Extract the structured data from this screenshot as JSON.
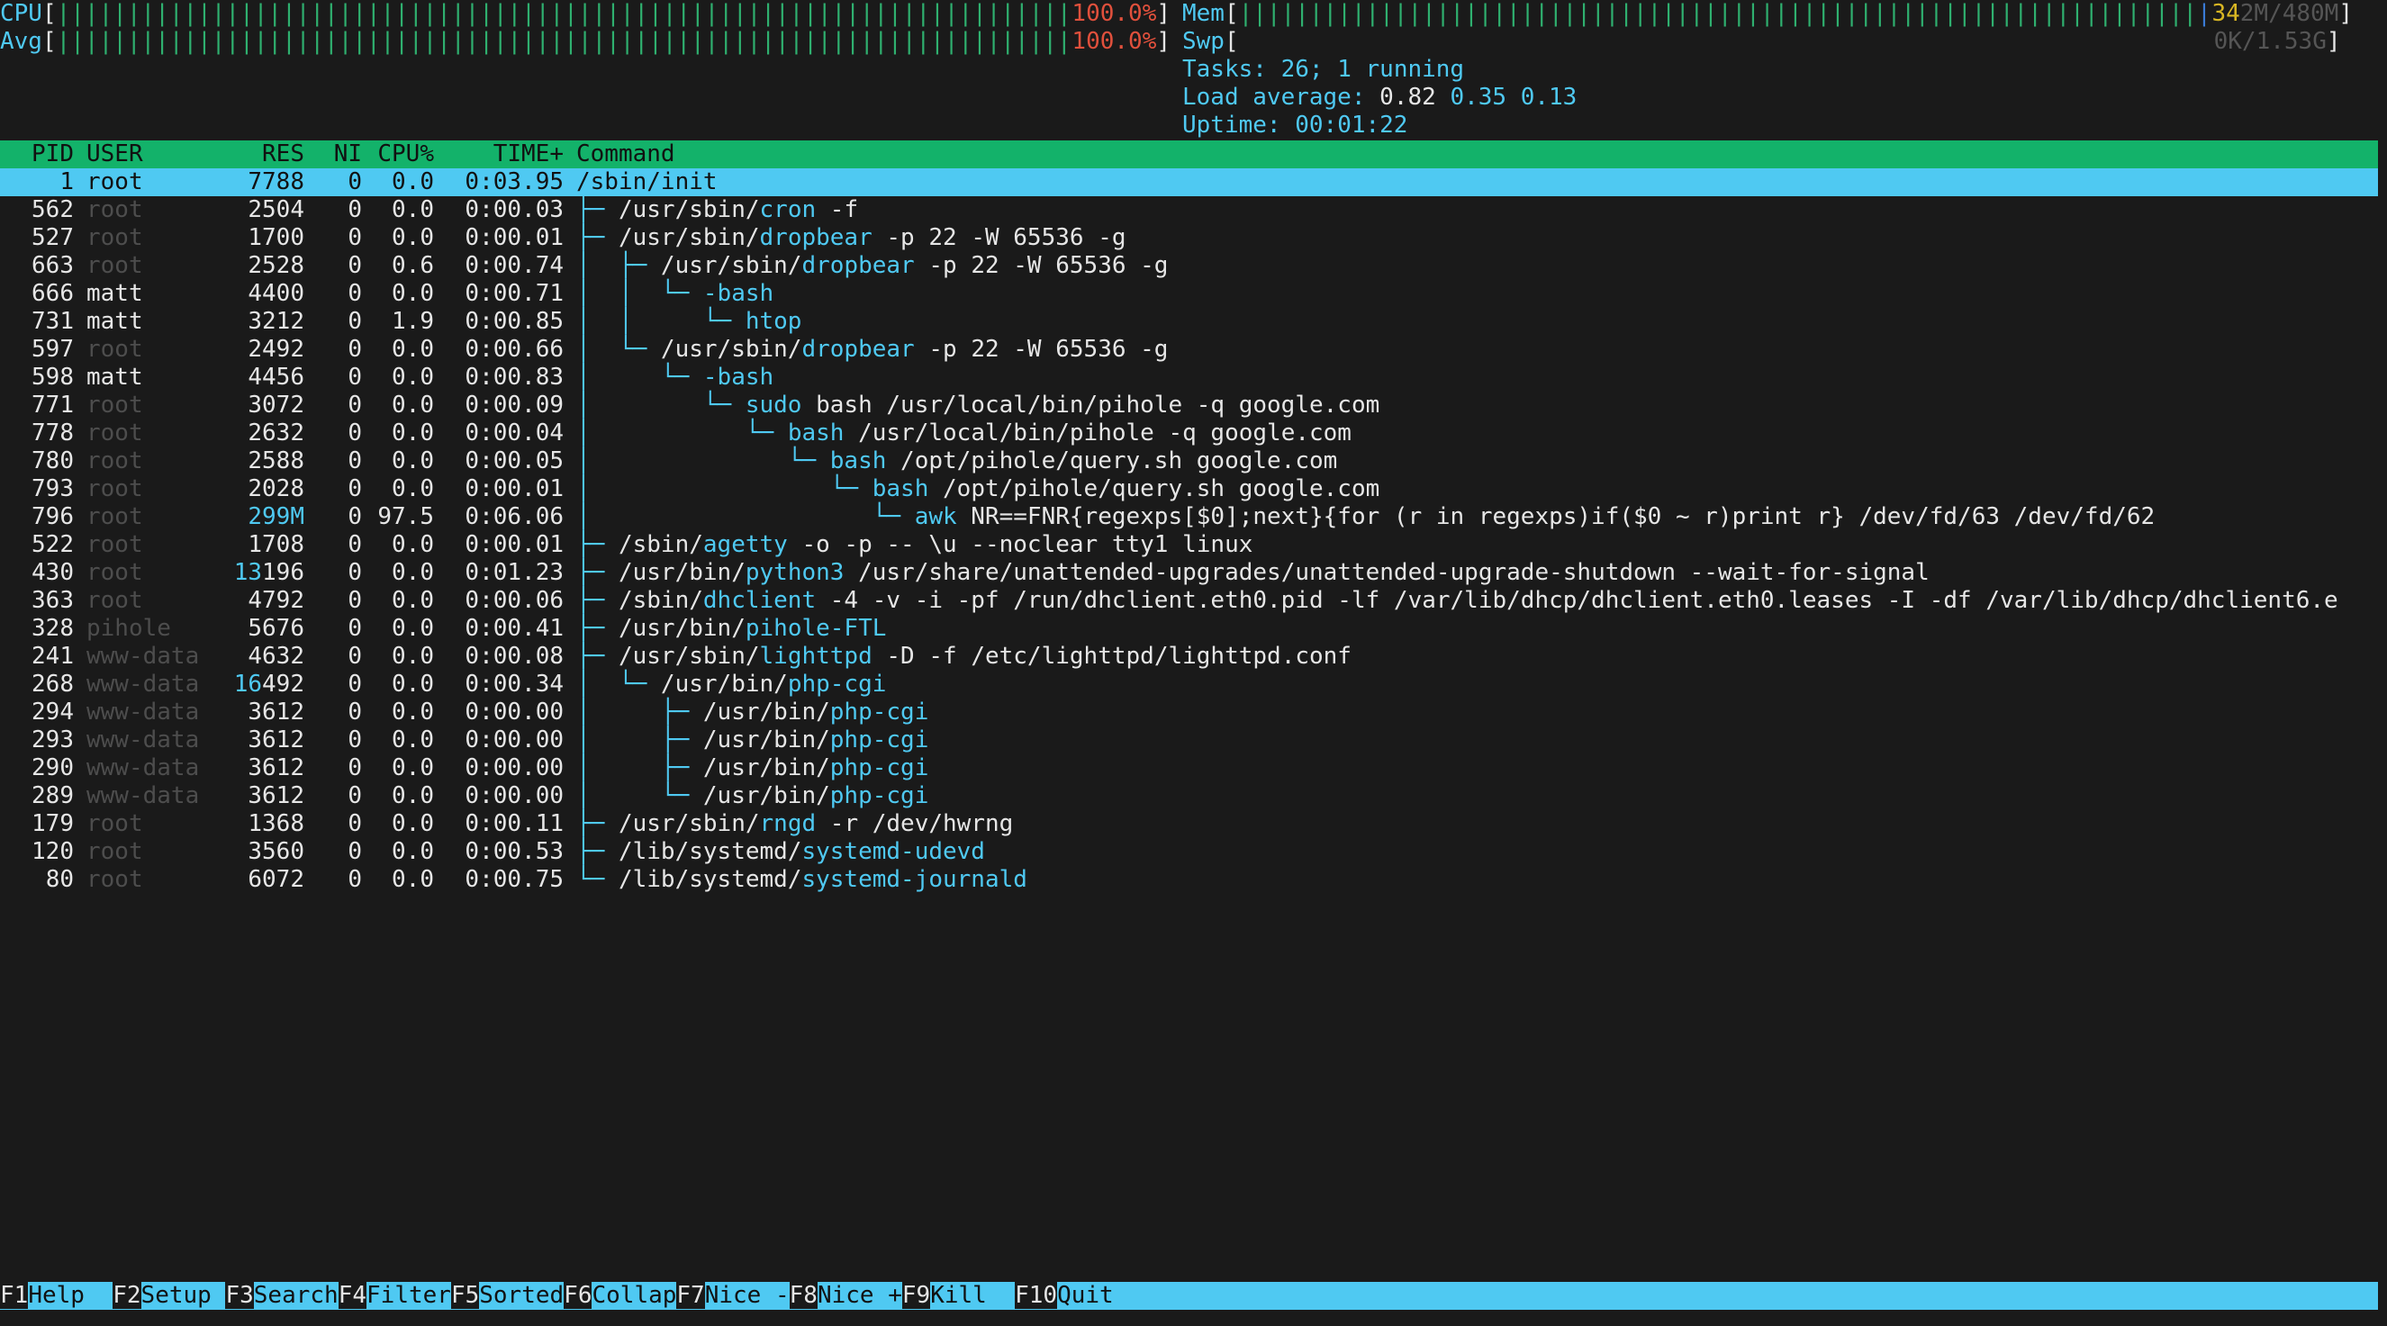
{
  "meters": {
    "cpu": {
      "label": "CPU",
      "percent_text": "100.0%",
      "fill": 1.0
    },
    "avg": {
      "label": "Avg",
      "percent_text": "100.0%",
      "fill": 1.0
    },
    "mem": {
      "label": "Mem",
      "text_bright": "34",
      "text_dim": "2M/480M",
      "fill": 1.0
    },
    "swp": {
      "label": "Swp",
      "text": "0K/1.53G",
      "fill": 0.0
    },
    "tasks": {
      "label": "Tasks:",
      "value": "26;",
      "running_count": "1",
      "running_label": "running"
    },
    "load": {
      "label": "Load average:",
      "v1": "0.82",
      "v5": "0.35",
      "v15": "0.13"
    },
    "uptime": {
      "label": "Uptime:",
      "value": "00:01:22"
    }
  },
  "columns": {
    "pid": "PID",
    "user": "USER",
    "res": "RES",
    "ni": "NI",
    "cpu": "CPU%",
    "time": "TIME+",
    "command": "Command"
  },
  "processes": [
    {
      "pid": "1",
      "user": "root",
      "res_a": "",
      "res_b": "7788",
      "ni": "0",
      "cpu": "0.0",
      "time": "0:03.95",
      "tree": "",
      "c1": "/sbin/init",
      "c2": "",
      "c3": ""
    },
    {
      "pid": "562",
      "user": "root",
      "res_a": "",
      "res_b": "2504",
      "ni": "0",
      "cpu": "0.0",
      "time": "0:00.03",
      "tree": "├─ ",
      "c1": "/usr/sbin/",
      "c2": "cron",
      "c3": " -f"
    },
    {
      "pid": "527",
      "user": "root",
      "res_a": "",
      "res_b": "1700",
      "ni": "0",
      "cpu": "0.0",
      "time": "0:00.01",
      "tree": "├─ ",
      "c1": "/usr/sbin/",
      "c2": "dropbear",
      "c3": " -p 22 -W 65536 -g"
    },
    {
      "pid": "663",
      "user": "root",
      "res_a": "",
      "res_b": "2528",
      "ni": "0",
      "cpu": "0.6",
      "time": "0:00.74",
      "tree": "│  ├─ ",
      "c1": "/usr/sbin/",
      "c2": "dropbear",
      "c3": " -p 22 -W 65536 -g"
    },
    {
      "pid": "666",
      "user": "matt",
      "res_a": "",
      "res_b": "4400",
      "ni": "0",
      "cpu": "0.0",
      "time": "0:00.71",
      "tree": "│  │  └─ ",
      "c1": "",
      "c2": "-bash",
      "c3": ""
    },
    {
      "pid": "731",
      "user": "matt",
      "res_a": "",
      "res_b": "3212",
      "ni": "0",
      "cpu": "1.9",
      "time": "0:00.85",
      "tree": "│  │     └─ ",
      "c1": "",
      "c2": "htop",
      "c3": ""
    },
    {
      "pid": "597",
      "user": "root",
      "res_a": "",
      "res_b": "2492",
      "ni": "0",
      "cpu": "0.0",
      "time": "0:00.66",
      "tree": "│  └─ ",
      "c1": "/usr/sbin/",
      "c2": "dropbear",
      "c3": " -p 22 -W 65536 -g"
    },
    {
      "pid": "598",
      "user": "matt",
      "res_a": "",
      "res_b": "4456",
      "ni": "0",
      "cpu": "0.0",
      "time": "0:00.83",
      "tree": "│     └─ ",
      "c1": "",
      "c2": "-bash",
      "c3": ""
    },
    {
      "pid": "771",
      "user": "root",
      "res_a": "",
      "res_b": "3072",
      "ni": "0",
      "cpu": "0.0",
      "time": "0:00.09",
      "tree": "│        └─ ",
      "c1": "",
      "c2": "sudo",
      "c3": " bash /usr/local/bin/pihole -q google.com"
    },
    {
      "pid": "778",
      "user": "root",
      "res_a": "",
      "res_b": "2632",
      "ni": "0",
      "cpu": "0.0",
      "time": "0:00.04",
      "tree": "│           └─ ",
      "c1": "",
      "c2": "bash",
      "c3": " /usr/local/bin/pihole -q google.com"
    },
    {
      "pid": "780",
      "user": "root",
      "res_a": "",
      "res_b": "2588",
      "ni": "0",
      "cpu": "0.0",
      "time": "0:00.05",
      "tree": "│              └─ ",
      "c1": "",
      "c2": "bash",
      "c3": " /opt/pihole/query.sh google.com"
    },
    {
      "pid": "793",
      "user": "root",
      "res_a": "",
      "res_b": "2028",
      "ni": "0",
      "cpu": "0.0",
      "time": "0:00.01",
      "tree": "│                 └─ ",
      "c1": "",
      "c2": "bash",
      "c3": " /opt/pihole/query.sh google.com"
    },
    {
      "pid": "796",
      "user": "root",
      "res_a": "299M",
      "res_b": "",
      "ni": "0",
      "cpu": "97.5",
      "time": "0:06.06",
      "tree": "│                    └─ ",
      "c1": "",
      "c2": "awk",
      "c3": " NR==FNR{regexps[$0];next}{for (r in regexps)if($0 ~ r)print r} /dev/fd/63 /dev/fd/62"
    },
    {
      "pid": "522",
      "user": "root",
      "res_a": "",
      "res_b": "1708",
      "ni": "0",
      "cpu": "0.0",
      "time": "0:00.01",
      "tree": "├─ ",
      "c1": "/sbin/",
      "c2": "agetty",
      "c3": " -o -p -- \\u --noclear tty1 linux"
    },
    {
      "pid": "430",
      "user": "root",
      "res_a": "13",
      "res_b": "196",
      "ni": "0",
      "cpu": "0.0",
      "time": "0:01.23",
      "tree": "├─ ",
      "c1": "/usr/bin/",
      "c2": "python3",
      "c3": " /usr/share/unattended-upgrades/unattended-upgrade-shutdown --wait-for-signal"
    },
    {
      "pid": "363",
      "user": "root",
      "res_a": "",
      "res_b": "4792",
      "ni": "0",
      "cpu": "0.0",
      "time": "0:00.06",
      "tree": "├─ ",
      "c1": "/sbin/",
      "c2": "dhclient",
      "c3": " -4 -v -i -pf /run/dhclient.eth0.pid -lf /var/lib/dhcp/dhclient.eth0.leases -I -df /var/lib/dhcp/dhclient6.e"
    },
    {
      "pid": "328",
      "user": "pihole",
      "res_a": "",
      "res_b": "5676",
      "ni": "0",
      "cpu": "0.0",
      "time": "0:00.41",
      "tree": "├─ ",
      "c1": "/usr/bin/",
      "c2": "pihole-FTL",
      "c3": ""
    },
    {
      "pid": "241",
      "user": "www-data",
      "res_a": "",
      "res_b": "4632",
      "ni": "0",
      "cpu": "0.0",
      "time": "0:00.08",
      "tree": "├─ ",
      "c1": "/usr/sbin/",
      "c2": "lighttpd",
      "c3": " -D -f /etc/lighttpd/lighttpd.conf"
    },
    {
      "pid": "268",
      "user": "www-data",
      "res_a": "16",
      "res_b": "492",
      "ni": "0",
      "cpu": "0.0",
      "time": "0:00.34",
      "tree": "│  └─ ",
      "c1": "/usr/bin/",
      "c2": "php-cgi",
      "c3": ""
    },
    {
      "pid": "294",
      "user": "www-data",
      "res_a": "",
      "res_b": "3612",
      "ni": "0",
      "cpu": "0.0",
      "time": "0:00.00",
      "tree": "│     ├─ ",
      "c1": "/usr/bin/",
      "c2": "php-cgi",
      "c3": ""
    },
    {
      "pid": "293",
      "user": "www-data",
      "res_a": "",
      "res_b": "3612",
      "ni": "0",
      "cpu": "0.0",
      "time": "0:00.00",
      "tree": "│     ├─ ",
      "c1": "/usr/bin/",
      "c2": "php-cgi",
      "c3": ""
    },
    {
      "pid": "290",
      "user": "www-data",
      "res_a": "",
      "res_b": "3612",
      "ni": "0",
      "cpu": "0.0",
      "time": "0:00.00",
      "tree": "│     ├─ ",
      "c1": "/usr/bin/",
      "c2": "php-cgi",
      "c3": ""
    },
    {
      "pid": "289",
      "user": "www-data",
      "res_a": "",
      "res_b": "3612",
      "ni": "0",
      "cpu": "0.0",
      "time": "0:00.00",
      "tree": "│     └─ ",
      "c1": "/usr/bin/",
      "c2": "php-cgi",
      "c3": ""
    },
    {
      "pid": "179",
      "user": "root",
      "res_a": "",
      "res_b": "1368",
      "ni": "0",
      "cpu": "0.0",
      "time": "0:00.11",
      "tree": "├─ ",
      "c1": "/usr/sbin/",
      "c2": "rngd",
      "c3": " -r /dev/hwrng"
    },
    {
      "pid": "120",
      "user": "root",
      "res_a": "",
      "res_b": "3560",
      "ni": "0",
      "cpu": "0.0",
      "time": "0:00.53",
      "tree": "├─ ",
      "c1": "/lib/systemd/",
      "c2": "systemd-udevd",
      "c3": ""
    },
    {
      "pid": "80",
      "user": "root",
      "res_a": "",
      "res_b": "6072",
      "ni": "0",
      "cpu": "0.0",
      "time": "0:00.75",
      "tree": "└─ ",
      "c1": "/lib/systemd/",
      "c2": "systemd-journald",
      "c3": ""
    }
  ],
  "footer": [
    {
      "key": "F1",
      "label": "Help  "
    },
    {
      "key": "F2",
      "label": "Setup "
    },
    {
      "key": "F3",
      "label": "Search"
    },
    {
      "key": "F4",
      "label": "Filter"
    },
    {
      "key": "F5",
      "label": "Sorted"
    },
    {
      "key": "F6",
      "label": "Collap"
    },
    {
      "key": "F7",
      "label": "Nice -"
    },
    {
      "key": "F8",
      "label": "Nice +"
    },
    {
      "key": "F9",
      "label": "Kill  "
    },
    {
      "key": "F10",
      "label": "Quit  "
    }
  ],
  "selected_index": 0,
  "colors": {
    "header_bg": "#13b26a",
    "selection_bg": "#4fc9f2",
    "accent": "#4fc9f2",
    "bar_green": "#2fb06f",
    "bar_red": "#e0503c"
  }
}
